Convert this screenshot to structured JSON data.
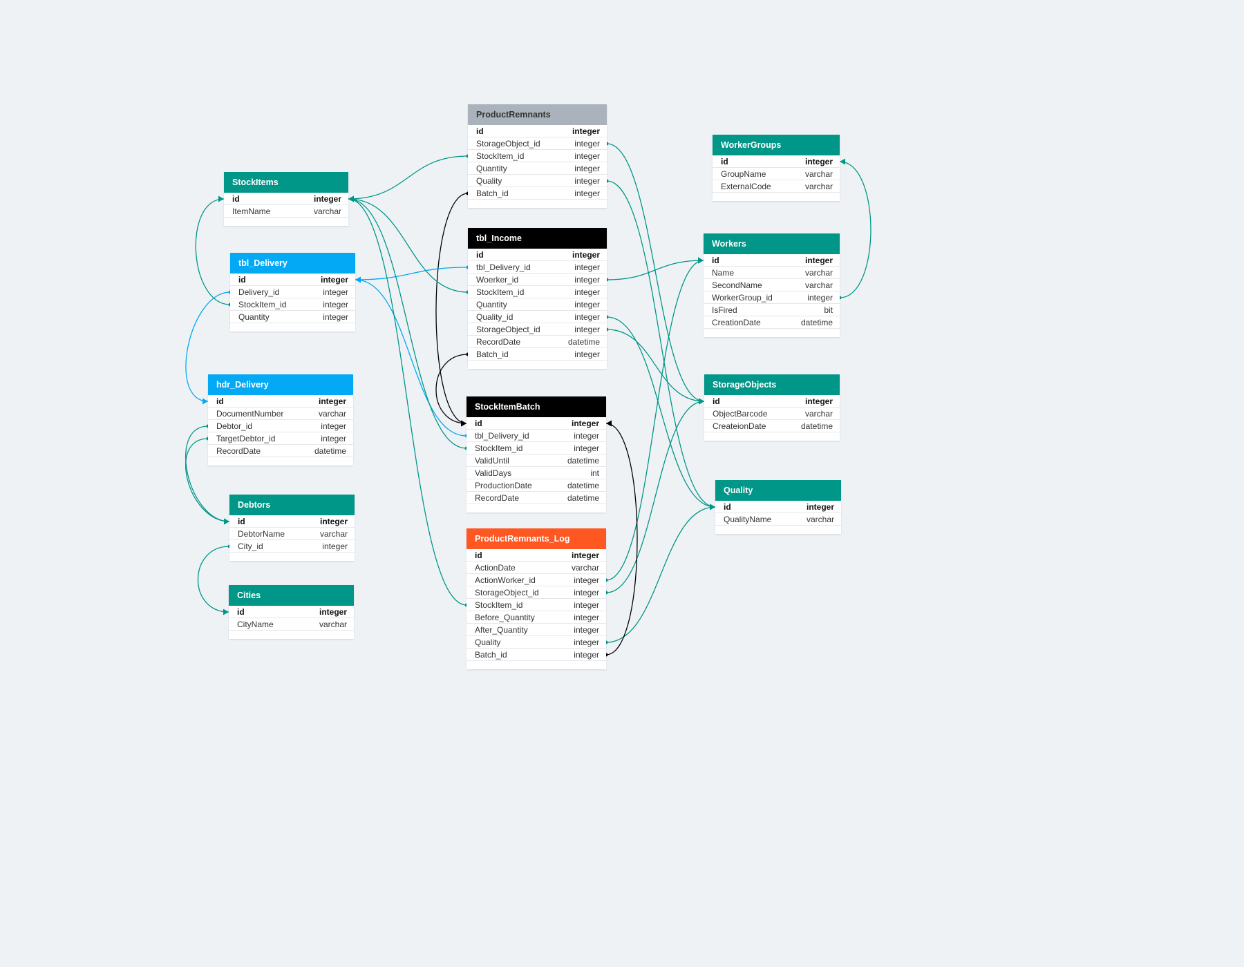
{
  "colors": {
    "background": "#eef2f5",
    "teal": "#009688",
    "blue": "#03a9f4",
    "black": "#000000",
    "gray": "#aab3bb",
    "orange": "#ff5722"
  },
  "tables": [
    {
      "id": "productremnants",
      "name": "ProductRemnants",
      "color": "#aab3bb",
      "textDark": true,
      "columns": [
        [
          "id",
          "integer"
        ],
        [
          "StorageObject_id",
          "integer"
        ],
        [
          "StockItem_id",
          "integer"
        ],
        [
          "Quantity",
          "integer"
        ],
        [
          "Quality",
          "integer"
        ],
        [
          "Batch_id",
          "integer"
        ]
      ]
    },
    {
      "id": "workergroups",
      "name": "WorkerGroups",
      "color": "#009688",
      "columns": [
        [
          "id",
          "integer"
        ],
        [
          "GroupName",
          "varchar"
        ],
        [
          "ExternalCode",
          "varchar"
        ]
      ]
    },
    {
      "id": "stockitems",
      "name": "StockItems",
      "color": "#009688",
      "columns": [
        [
          "id",
          "integer"
        ],
        [
          "ItemName",
          "varchar"
        ]
      ]
    },
    {
      "id": "tbl_income",
      "name": "tbl_Income",
      "color": "#000000",
      "columns": [
        [
          "id",
          "integer"
        ],
        [
          "tbl_Delivery_id",
          "integer"
        ],
        [
          "Woerker_id",
          "integer"
        ],
        [
          "StockItem_id",
          "integer"
        ],
        [
          "Quantity",
          "integer"
        ],
        [
          "Quality_id",
          "integer"
        ],
        [
          "StorageObject_id",
          "integer"
        ],
        [
          "RecordDate",
          "datetime"
        ],
        [
          "Batch_id",
          "integer"
        ]
      ]
    },
    {
      "id": "workers",
      "name": "Workers",
      "color": "#009688",
      "columns": [
        [
          "id",
          "integer"
        ],
        [
          "Name",
          "varchar"
        ],
        [
          "SecondName",
          "varchar"
        ],
        [
          "WorkerGroup_id",
          "integer"
        ],
        [
          "IsFired",
          "bit"
        ],
        [
          "CreationDate",
          "datetime"
        ]
      ]
    },
    {
      "id": "tbl_delivery",
      "name": "tbl_Delivery",
      "color": "#03a9f4",
      "columns": [
        [
          "id",
          "integer"
        ],
        [
          "Delivery_id",
          "integer"
        ],
        [
          "StockItem_id",
          "integer"
        ],
        [
          "Quantity",
          "integer"
        ]
      ]
    },
    {
      "id": "hdr_delivery",
      "name": "hdr_Delivery",
      "color": "#03a9f4",
      "columns": [
        [
          "id",
          "integer"
        ],
        [
          "DocumentNumber",
          "varchar"
        ],
        [
          "Debtor_id",
          "integer"
        ],
        [
          "TargetDebtor_id",
          "integer"
        ],
        [
          "RecordDate",
          "datetime"
        ]
      ]
    },
    {
      "id": "storageobjects",
      "name": "StorageObjects",
      "color": "#009688",
      "columns": [
        [
          "id",
          "integer"
        ],
        [
          "ObjectBarcode",
          "varchar"
        ],
        [
          "CreateionDate",
          "datetime"
        ]
      ]
    },
    {
      "id": "stockitembatch",
      "name": "StockItemBatch",
      "color": "#000000",
      "columns": [
        [
          "id",
          "integer"
        ],
        [
          "tbl_Delivery_id",
          "integer"
        ],
        [
          "StockItem_id",
          "integer"
        ],
        [
          "ValidUntil",
          "datetime"
        ],
        [
          "ValidDays",
          "int"
        ],
        [
          "ProductionDate",
          "datetime"
        ],
        [
          "RecordDate",
          "datetime"
        ]
      ]
    },
    {
      "id": "quality",
      "name": "Quality",
      "color": "#009688",
      "columns": [
        [
          "id",
          "integer"
        ],
        [
          "QualityName",
          "varchar"
        ]
      ]
    },
    {
      "id": "debtors",
      "name": "Debtors",
      "color": "#009688",
      "columns": [
        [
          "id",
          "integer"
        ],
        [
          "DebtorName",
          "varchar"
        ],
        [
          "City_id",
          "integer"
        ]
      ]
    },
    {
      "id": "productremnants_log",
      "name": "ProductRemnants_Log",
      "color": "#ff5722",
      "columns": [
        [
          "id",
          "integer"
        ],
        [
          "ActionDate",
          "varchar"
        ],
        [
          "ActionWorker_id",
          "integer"
        ],
        [
          "StorageObject_id",
          "integer"
        ],
        [
          "StockItem_id",
          "integer"
        ],
        [
          "Before_Quantity",
          "integer"
        ],
        [
          "After_Quantity",
          "integer"
        ],
        [
          "Quality",
          "integer"
        ],
        [
          "Batch_id",
          "integer"
        ]
      ]
    },
    {
      "id": "cities",
      "name": "Cities",
      "color": "#009688",
      "columns": [
        [
          "id",
          "integer"
        ],
        [
          "CityName",
          "varchar"
        ]
      ]
    }
  ],
  "relations": [
    {
      "from": "productremnants.StorageObject_id",
      "to": "storageobjects.id",
      "color": "#009688"
    },
    {
      "from": "productremnants.StockItem_id",
      "to": "stockitems.id",
      "color": "#009688"
    },
    {
      "from": "productremnants.Quality",
      "to": "quality.id",
      "color": "#009688"
    },
    {
      "from": "productremnants.Batch_id",
      "to": "stockitembatch.id",
      "color": "#000000"
    },
    {
      "from": "workers.WorkerGroup_id",
      "to": "workergroups.id",
      "color": "#009688"
    },
    {
      "from": "tbl_delivery.StockItem_id",
      "to": "stockitems.id",
      "color": "#009688"
    },
    {
      "from": "tbl_delivery.Delivery_id",
      "to": "hdr_delivery.id",
      "color": "#03a9f4"
    },
    {
      "from": "tbl_income.tbl_Delivery_id",
      "to": "tbl_delivery.id",
      "color": "#03a9f4"
    },
    {
      "from": "tbl_income.Woerker_id",
      "to": "workers.id",
      "color": "#009688"
    },
    {
      "from": "tbl_income.StockItem_id",
      "to": "stockitems.id",
      "color": "#009688"
    },
    {
      "from": "tbl_income.Quality_id",
      "to": "quality.id",
      "color": "#009688"
    },
    {
      "from": "tbl_income.StorageObject_id",
      "to": "storageobjects.id",
      "color": "#009688"
    },
    {
      "from": "tbl_income.Batch_id",
      "to": "stockitembatch.id",
      "color": "#000000"
    },
    {
      "from": "stockitembatch.tbl_Delivery_id",
      "to": "tbl_delivery.id",
      "color": "#03a9f4"
    },
    {
      "from": "stockitembatch.StockItem_id",
      "to": "stockitems.id",
      "color": "#009688"
    },
    {
      "from": "hdr_delivery.Debtor_id",
      "to": "debtors.id",
      "color": "#009688"
    },
    {
      "from": "hdr_delivery.TargetDebtor_id",
      "to": "debtors.id",
      "color": "#009688"
    },
    {
      "from": "debtors.City_id",
      "to": "cities.id",
      "color": "#009688"
    },
    {
      "from": "productremnants_log.ActionWorker_id",
      "to": "workers.id",
      "color": "#009688"
    },
    {
      "from": "productremnants_log.StorageObject_id",
      "to": "storageobjects.id",
      "color": "#009688"
    },
    {
      "from": "productremnants_log.StockItem_id",
      "to": "stockitems.id",
      "color": "#009688"
    },
    {
      "from": "productremnants_log.Quality",
      "to": "quality.id",
      "color": "#009688"
    },
    {
      "from": "productremnants_log.Batch_id",
      "to": "stockitembatch.id",
      "color": "#000000"
    }
  ]
}
